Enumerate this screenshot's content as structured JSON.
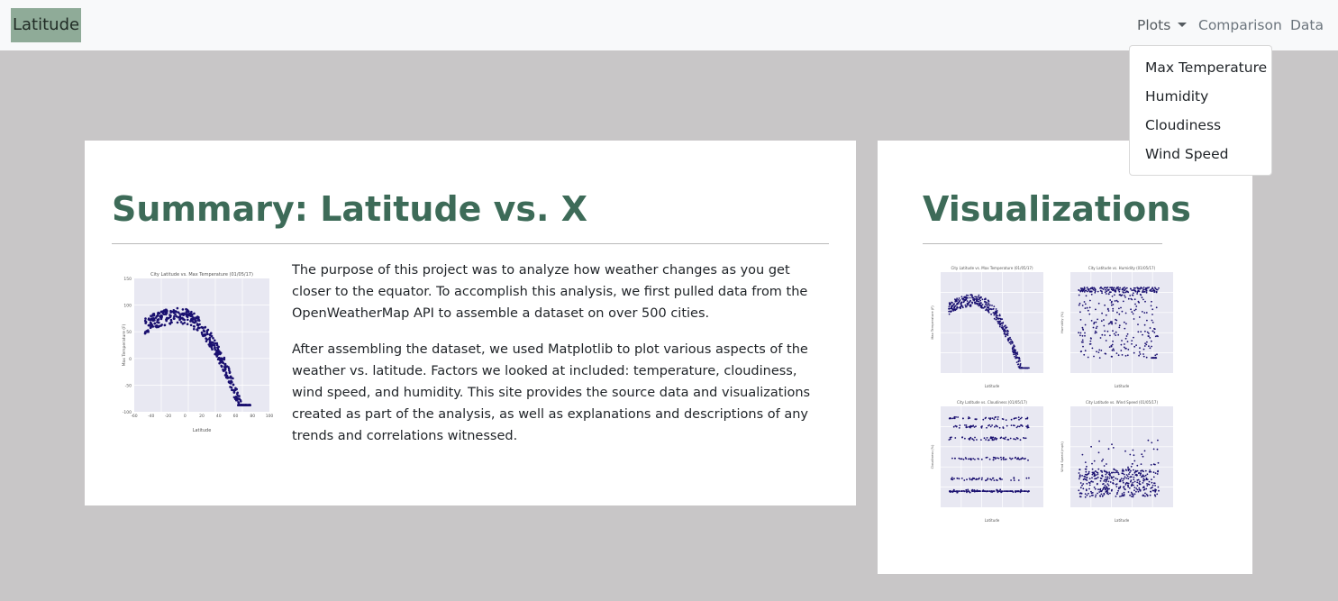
{
  "navbar": {
    "brand": "Latitude",
    "links": {
      "plots": "Plots",
      "comparison": "Comparison",
      "data": "Data"
    },
    "dropdown": [
      "Max Temperature",
      "Humidity",
      "Cloudiness",
      "Wind Speed"
    ]
  },
  "summary": {
    "title": "Summary: Latitude vs. X",
    "paragraphs": [
      "The purpose of this project was to analyze how weather changes as you get closer to the equator. To accomplish this analysis, we first pulled data from the OpenWeatherMap API to assemble a dataset on over 500 cities.",
      "After assembling the dataset, we used Matplotlib to plot various aspects of the weather vs. latitude. Factors we looked at included: temperature, cloudiness, wind speed, and humidity. This site provides the source data and visualizations created as part of the analysis, as well as explanations and descriptions of any trends and correlations witnessed."
    ]
  },
  "visualizations": {
    "title": "Visualizations"
  },
  "plots": {
    "main": {
      "title": "City Latitude vs. Max Temperature (01/05/17)",
      "xlabel": "Latitude",
      "ylabel": "Max Temperature (F)",
      "yticks": [
        "150",
        "100",
        "50",
        "0",
        "-50",
        "-100"
      ],
      "xticks": [
        "-60",
        "-40",
        "-20",
        "0",
        "20",
        "40",
        "60",
        "80",
        "100"
      ]
    },
    "temp": {
      "title": "City Latitude vs. Max Temperature (01/05/17)",
      "xlabel": "Latitude",
      "ylabel": "Max Temperature (F)"
    },
    "humidity": {
      "title": "City Latitude vs. Humidity (01/05/17)",
      "xlabel": "Latitude",
      "ylabel": "Humidity (%)"
    },
    "cloud": {
      "title": "City Latitude vs. Cloudiness (01/05/17)",
      "xlabel": "Latitude",
      "ylabel": "Cloudiness (%)"
    },
    "wind": {
      "title": "City Latitude vs. Wind Speed (01/05/17)",
      "xlabel": "Latitude",
      "ylabel": "Wind Speed (mph)"
    }
  },
  "colors": {
    "brand_bg": "#8fab98",
    "heading": "#3d6b58",
    "page_bg": "#c8c6c7",
    "point": "#1a1070",
    "plot_bg": "#e8e8f2"
  }
}
